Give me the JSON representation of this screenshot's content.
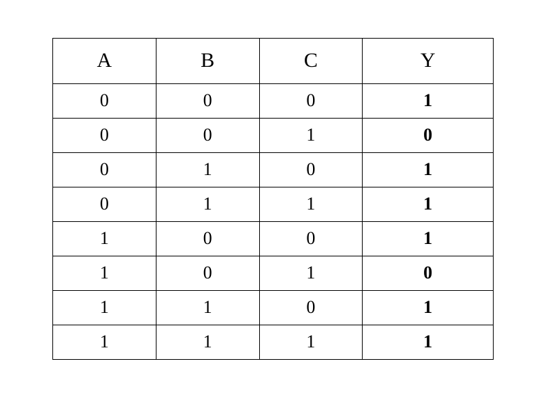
{
  "chart_data": {
    "type": "table",
    "headers": [
      "A",
      "B",
      "C",
      "Y"
    ],
    "rows": [
      {
        "A": "0",
        "B": "0",
        "C": "0",
        "Y": "1"
      },
      {
        "A": "0",
        "B": "0",
        "C": "1",
        "Y": "0"
      },
      {
        "A": "0",
        "B": "1",
        "C": "0",
        "Y": "1"
      },
      {
        "A": "0",
        "B": "1",
        "C": "1",
        "Y": "1"
      },
      {
        "A": "1",
        "B": "0",
        "C": "0",
        "Y": "1"
      },
      {
        "A": "1",
        "B": "0",
        "C": "1",
        "Y": "0"
      },
      {
        "A": "1",
        "B": "1",
        "C": "0",
        "Y": "1"
      },
      {
        "A": "1",
        "B": "1",
        "C": "1",
        "Y": "1"
      }
    ]
  }
}
